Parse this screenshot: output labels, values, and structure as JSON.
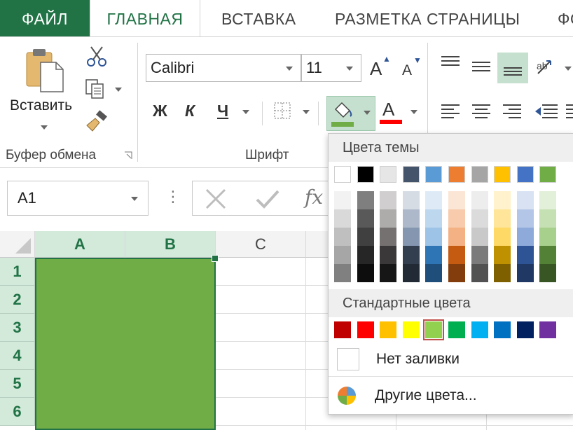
{
  "tabs": {
    "file": "ФАЙЛ",
    "home": "ГЛАВНАЯ",
    "insert": "ВСТАВКА",
    "layout": "РАЗМЕТКА СТРАНИЦЫ",
    "cut": "ФО"
  },
  "clipboard": {
    "paste_label": "Вставить",
    "group_label": "Буфер обмена"
  },
  "font": {
    "name": "Calibri",
    "size": "11",
    "group_label": "Шрифт",
    "bold": "Ж",
    "italic": "К",
    "underline": "Ч",
    "increase": "A",
    "decrease": "A",
    "color_letter": "A"
  },
  "namebox": {
    "value": "A1"
  },
  "formula": {
    "fx": "fx",
    "dots": "⋮"
  },
  "grid": {
    "columns": [
      "A",
      "B",
      "C"
    ],
    "rows": [
      "1",
      "2",
      "3",
      "4",
      "5",
      "6"
    ]
  },
  "fill_menu": {
    "theme_header": "Цвета темы",
    "standard_header": "Стандартные цвета",
    "no_fill": "Нет заливки",
    "more_colors": "Другие цвета..."
  },
  "colors": {
    "accent": "#217346",
    "fill_green": "#70ad47",
    "selected_header": "#d3eadb"
  },
  "theme_colors": [
    {
      "base": "#ffffff",
      "shades": [
        "#f2f2f2",
        "#d9d9d9",
        "#bfbfbf",
        "#a6a6a6",
        "#808080"
      ]
    },
    {
      "base": "#000000",
      "shades": [
        "#7f7f7f",
        "#595959",
        "#404040",
        "#262626",
        "#0d0d0d"
      ]
    },
    {
      "base": "#e7e6e6",
      "shades": [
        "#d0cece",
        "#aeabab",
        "#757171",
        "#3a3838",
        "#171616"
      ]
    },
    {
      "base": "#44546a",
      "shades": [
        "#d6dce4",
        "#adb9ca",
        "#8496b0",
        "#333f4f",
        "#222a35"
      ]
    },
    {
      "base": "#5b9bd5",
      "shades": [
        "#deebf6",
        "#bdd7ee",
        "#9dc3e6",
        "#2e75b5",
        "#1e4e79"
      ]
    },
    {
      "base": "#ed7d31",
      "shades": [
        "#fbe5d5",
        "#f7cbac",
        "#f4b183",
        "#c55a11",
        "#833c0b"
      ]
    },
    {
      "base": "#a5a5a5",
      "shades": [
        "#ededed",
        "#dbdbdb",
        "#c9c9c9",
        "#7b7b7b",
        "#525252"
      ]
    },
    {
      "base": "#ffc000",
      "shades": [
        "#fff2cc",
        "#fee599",
        "#ffd965",
        "#bf9000",
        "#7f6000"
      ]
    },
    {
      "base": "#4472c4",
      "shades": [
        "#d9e2f3",
        "#b4c6e7",
        "#8eaadb",
        "#2f5496",
        "#1f3864"
      ]
    },
    {
      "base": "#70ad47",
      "shades": [
        "#e2efd9",
        "#c5e0b3",
        "#a8d08d",
        "#538135",
        "#375623"
      ]
    }
  ],
  "standard_colors": [
    "#c00000",
    "#ff0000",
    "#ffc000",
    "#ffff00",
    "#92d050",
    "#00b050",
    "#00b0f0",
    "#0070c0",
    "#002060",
    "#7030a0"
  ],
  "icons": {
    "paste": "clipboard-icon",
    "cut": "scissors-icon",
    "copy": "copy-icon",
    "painter": "format-painter-icon",
    "fill": "fill-bucket-icon",
    "border": "border-icon",
    "cancel": "cancel-icon",
    "enter": "check-icon",
    "palette": "palette-icon"
  }
}
